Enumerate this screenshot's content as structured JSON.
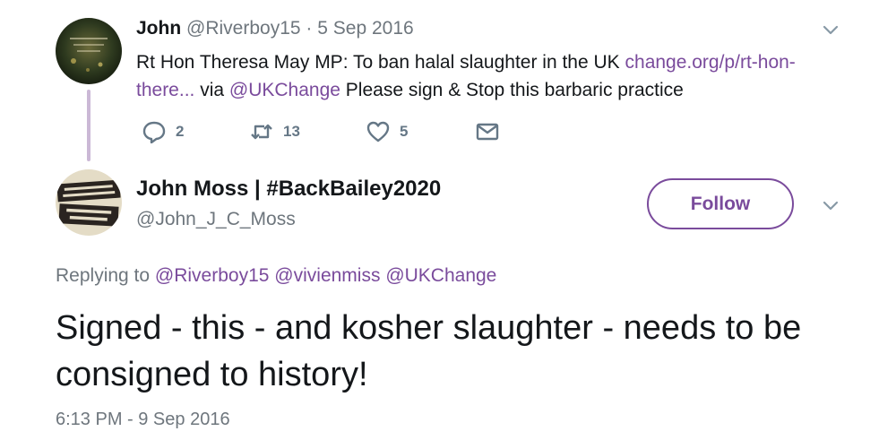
{
  "tweet1": {
    "name": "John",
    "handle": "@Riverboy15",
    "separator": "·",
    "date": "5 Sep 2016",
    "text_before": "Rt Hon Theresa May MP: To ban halal slaughter in the UK ",
    "link_text": "change.org/p/rt-hon-there...",
    "text_via": " via ",
    "mention": "@UKChange",
    "text_after": " Please sign & Stop this barbaric practice",
    "reply_count": "2",
    "retweet_count": "13",
    "like_count": "5",
    "avatar_icon": "forest-avatar"
  },
  "tweet2": {
    "name": "John Moss | #BackBailey2020",
    "handle": "@John_J_C_Moss",
    "follow_label": "Follow",
    "replying_prefix": "Replying to ",
    "replying_to": [
      "@Riverboy15",
      "@vivienmiss",
      "@UKChange"
    ],
    "text": "Signed - this - and kosher slaughter - needs to be consigned to history!",
    "timestamp": "6:13 PM - 9 Sep 2016",
    "avatar_icon": "labour-income-taxes-avatar"
  },
  "colors": {
    "accent": "#7a4b9c",
    "muted_text": "#6e767d",
    "icon_gray": "#657786",
    "thread_line": "#cbb8d6"
  }
}
